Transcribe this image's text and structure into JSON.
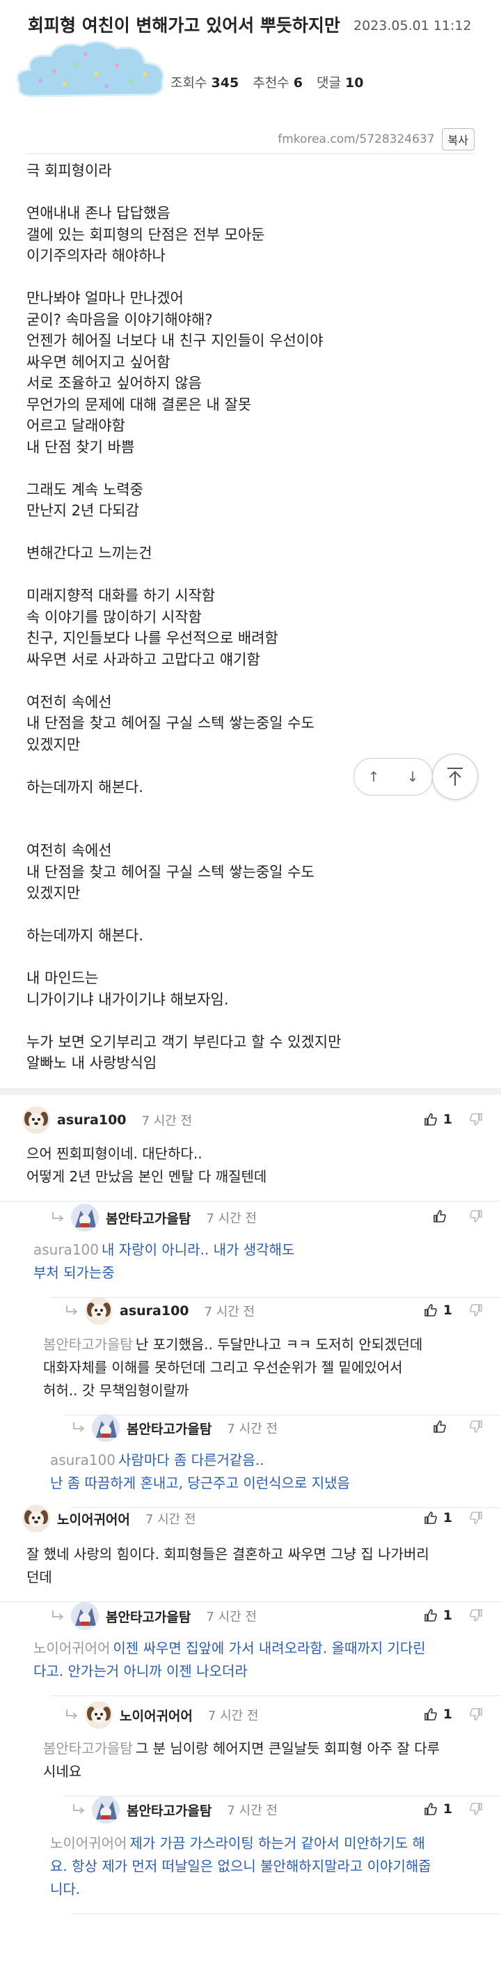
{
  "post": {
    "title": "회피형 여친이 변해가고 있어서 뿌듯하지만",
    "date": "2023.05.01 11:12",
    "views_label": "조회수",
    "views": "345",
    "likes_label": "추천수",
    "likes": "6",
    "comments_label": "댓글",
    "comments": "10",
    "url": "fmkorea.com/5728324637",
    "copy_label": "복사",
    "body": [
      "극 회피형이라",
      "",
      "연애내내 존나 답답했음",
      "갤에 있는 회피형의 단점은 전부 모아둔",
      "이기주의자라 해야하나",
      "",
      "만나봐야 얼마나 만나겠어",
      "굳이? 속마음을 이야기해야해?",
      "언젠가 헤어질 너보다 내 친구 지인들이 우선이야",
      "싸우면 헤어지고 싶어함",
      "서로 조율하고 싶어하지 않음",
      "무언가의 문제에 대해 결론은 내 잘못",
      "어르고 달래야함",
      "내 단점 찾기 바쁨",
      "",
      "그래도 계속 노력중",
      "만난지 2년 다되감",
      "",
      "변해간다고 느끼는건",
      "",
      "미래지향적 대화를 하기 시작함",
      "속 이야기를 많이하기 시작함",
      "친구, 지인들보다 나를 우선적으로 배려함",
      "싸우면 서로 사과하고 고맙다고 얘기함",
      "",
      "여전히 속에선",
      "내 단점을 찾고 헤어질 구실 스텍 쌓는중일 수도",
      "있겠지만",
      "",
      "하는데까지 해본다.",
      "",
      "",
      "여전히 속에선",
      "내 단점을 찾고 헤어질 구실 스텍 쌓는중일 수도",
      "있겠지만",
      "",
      "하는데까지 해본다.",
      "",
      "내 마인드는",
      "니가이기냐 내가이기냐 해보자임.",
      "",
      "누가 보면 오기부리고 객기 부린다고 할 수 있겠지만",
      "알빠노 내 사랑방식임"
    ]
  },
  "comments": [
    {
      "nick": "asura100",
      "time": "7 시간 전",
      "likes": "1",
      "mention": "",
      "lines": [
        "으어 찐회피형이네. 대단하다..",
        "어떻게 2년 만났음 본인 멘탈 다 깨질텐데"
      ]
    },
    {
      "nick": "봄안타고가을탐",
      "time": "7 시간 전",
      "likes": "",
      "mention": "asura100",
      "lines": [
        "내 자랑이 아니라.. 내가 생각해도",
        "부처 되가는중"
      ]
    },
    {
      "nick": "asura100",
      "time": "7 시간 전",
      "likes": "1",
      "mention": "봄안타고가을탐",
      "lines": [
        "난 포기했음.. 두달만나고 ㅋㅋ 도저히 안되겠던데",
        "대화자체를 이해를 못하던데 그리고 우선순위가 젤 밑에있어서",
        "허허.. 갓 무책임형이랄까"
      ]
    },
    {
      "nick": "봄안타고가을탐",
      "time": "7 시간 전",
      "likes": "",
      "mention": "asura100",
      "lines": [
        "사람마다 좀 다른거같음..",
        "난 좀 따끔하게 혼내고, 당근주고 이런식으로 지냈음"
      ]
    },
    {
      "nick": "노이어귀어어",
      "time": "7 시간 전",
      "likes": "1",
      "mention": "",
      "lines": [
        "잘 했네 사랑의 힘이다. 회피형들은 결혼하고 싸우면 그냥 집 나가버리",
        "던데"
      ]
    },
    {
      "nick": "봄안타고가을탐",
      "time": "7 시간 전",
      "likes": "1",
      "mention": "노이어귀어어",
      "lines": [
        "이젠 싸우면 집앞에 가서 내려오라함. 올때까지 기다린",
        "다고. 안가는거 아니까 이젠 나오더라"
      ]
    },
    {
      "nick": "노이어귀어어",
      "time": "7 시간 전",
      "likes": "1",
      "mention": "봄안타고가을탐",
      "lines": [
        "그 분 님이랑 헤어지면 큰일날듯 회피형 아주 잘 다루",
        "시네요"
      ]
    },
    {
      "nick": "봄안타고가을탐",
      "time": "7 시간 전",
      "likes": "1",
      "mention": "노이어귀어어",
      "lines": [
        "제가 가끔 가스라이팅 하는거 같아서 미안하기도 해",
        "요. 항상 제가 먼저 떠날일은 없으니 불안해하지말라고 이야기해줍",
        "니다."
      ]
    }
  ]
}
